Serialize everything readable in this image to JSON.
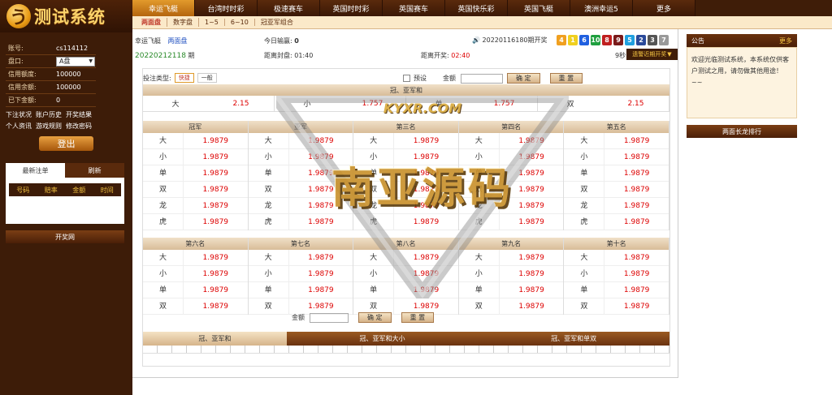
{
  "app": {
    "title": "测试系统",
    "logo_glyph": "う"
  },
  "nav": {
    "items": [
      "幸运飞艇",
      "台湾时时彩",
      "极速赛车",
      "英国时时彩",
      "英国赛车",
      "英国快乐彩",
      "英国飞艇",
      "澳洲幸运5",
      "更多"
    ],
    "active_index": 0
  },
  "subnav": {
    "items": [
      "两面盘",
      "数字盘",
      "1~5",
      "6~10",
      "冠亚军组合"
    ],
    "active_index": 0
  },
  "account": {
    "rows": [
      {
        "label": "账号:",
        "value": "cs114112"
      },
      {
        "label": "盘口:",
        "value": "A盘"
      },
      {
        "label": "信用额度:",
        "value": "100000"
      },
      {
        "label": "信用余额:",
        "value": "100000"
      },
      {
        "label": "已下金额:",
        "value": "0"
      }
    ],
    "links": [
      "下注状况",
      "账户历史",
      "开奖结果",
      "个人资讯",
      "游戏规则",
      "修改密码"
    ],
    "logout": "登出"
  },
  "recent": {
    "tabs": [
      "最新注单",
      "刷新"
    ],
    "columns": [
      "号码",
      "赔率",
      "金额",
      "时间"
    ]
  },
  "lottery_site": "开奖网",
  "status": {
    "game_name": "幸运飞艇",
    "game_mode": "两面盘",
    "period": "20220212118",
    "period_suffix": "期",
    "today_pl_label": "今日输赢:",
    "today_pl": "0",
    "close_label": "距离封盘:",
    "close_time": "01:40",
    "open_label": "距离开奖:",
    "open_time": "02:40",
    "last_period": "20220116180",
    "last_label": "期开奖",
    "balls": [
      {
        "n": "4",
        "color": "#f0a020"
      },
      {
        "n": "1",
        "color": "#f0d020"
      },
      {
        "n": "6",
        "color": "#2060e0"
      },
      {
        "n": "10",
        "color": "#20a040"
      },
      {
        "n": "8",
        "color": "#c02020"
      },
      {
        "n": "9",
        "color": "#7a1a1a"
      },
      {
        "n": "5",
        "color": "#20a0e0"
      },
      {
        "n": "2",
        "color": "#2a4a9a"
      },
      {
        "n": "3",
        "color": "#555555"
      },
      {
        "n": "7",
        "color": "#999999"
      }
    ],
    "countdown": "9秒",
    "alarm_btn": "遗警近期开奖"
  },
  "bet": {
    "type_label": "投注类型:",
    "type_buttons": [
      "快捷",
      "一般"
    ],
    "preset_label": "预设",
    "amount_label": "金额",
    "confirm": "确 定",
    "reset": "重 置",
    "gy_title": "冠、亚军和",
    "gy_items": [
      {
        "name": "大",
        "odds": "2.15"
      },
      {
        "name": "小",
        "odds": "1.757"
      },
      {
        "name": "单",
        "odds": "1.757"
      },
      {
        "name": "双",
        "odds": "2.15"
      }
    ],
    "grid1": [
      {
        "title": "冠军",
        "rows": [
          [
            "大",
            "1.9879"
          ],
          [
            "小",
            "1.9879"
          ],
          [
            "单",
            "1.9879"
          ],
          [
            "双",
            "1.9879"
          ],
          [
            "龙",
            "1.9879"
          ],
          [
            "虎",
            "1.9879"
          ]
        ]
      },
      {
        "title": "亚军",
        "rows": [
          [
            "大",
            "1.9879"
          ],
          [
            "小",
            "1.9879"
          ],
          [
            "单",
            "1.9879"
          ],
          [
            "双",
            "1.9879"
          ],
          [
            "龙",
            "1.9879"
          ],
          [
            "虎",
            "1.9879"
          ]
        ]
      },
      {
        "title": "第三名",
        "rows": [
          [
            "大",
            "1.9879"
          ],
          [
            "小",
            "1.9879"
          ],
          [
            "单",
            "1.9879"
          ],
          [
            "双",
            "1.9879"
          ],
          [
            "龙",
            "1.9879"
          ],
          [
            "虎",
            "1.9879"
          ]
        ]
      },
      {
        "title": "第四名",
        "rows": [
          [
            "大",
            "1.9879"
          ],
          [
            "小",
            "1.9879"
          ],
          [
            "单",
            "1.9879"
          ],
          [
            "双",
            "1.9879"
          ],
          [
            "龙",
            "1.9879"
          ],
          [
            "虎",
            "1.9879"
          ]
        ]
      },
      {
        "title": "第五名",
        "rows": [
          [
            "大",
            "1.9879"
          ],
          [
            "小",
            "1.9879"
          ],
          [
            "单",
            "1.9879"
          ],
          [
            "双",
            "1.9879"
          ],
          [
            "龙",
            "1.9879"
          ],
          [
            "虎",
            "1.9879"
          ]
        ]
      }
    ],
    "grid2": [
      {
        "title": "第六名",
        "rows": [
          [
            "大",
            "1.9879"
          ],
          [
            "小",
            "1.9879"
          ],
          [
            "单",
            "1.9879"
          ],
          [
            "双",
            "1.9879"
          ]
        ]
      },
      {
        "title": "第七名",
        "rows": [
          [
            "大",
            "1.9879"
          ],
          [
            "小",
            "1.9879"
          ],
          [
            "单",
            "1.9879"
          ],
          [
            "双",
            "1.9879"
          ]
        ]
      },
      {
        "title": "第八名",
        "rows": [
          [
            "大",
            "1.9879"
          ],
          [
            "小",
            "1.9879"
          ],
          [
            "单",
            "1.9879"
          ],
          [
            "双",
            "1.9879"
          ]
        ]
      },
      {
        "title": "第九名",
        "rows": [
          [
            "大",
            "1.9879"
          ],
          [
            "小",
            "1.9879"
          ],
          [
            "单",
            "1.9879"
          ],
          [
            "双",
            "1.9879"
          ]
        ]
      },
      {
        "title": "第十名",
        "rows": [
          [
            "大",
            "1.9879"
          ],
          [
            "小",
            "1.9879"
          ],
          [
            "单",
            "1.9879"
          ],
          [
            "双",
            "1.9879"
          ]
        ]
      }
    ],
    "bottom_tabs": [
      "冠、亚军和",
      "冠、亚军和大小",
      "冠、亚军和单双"
    ]
  },
  "notice": {
    "title": "公告",
    "more": "更多",
    "body": "欢迎光临测试系统，本系统仅供客户测试之用，请勿做其他用途！~~",
    "long_dragon": "两面长龙排行"
  },
  "watermark": {
    "text": "南亚源码",
    "url": "KYXR.COM"
  }
}
